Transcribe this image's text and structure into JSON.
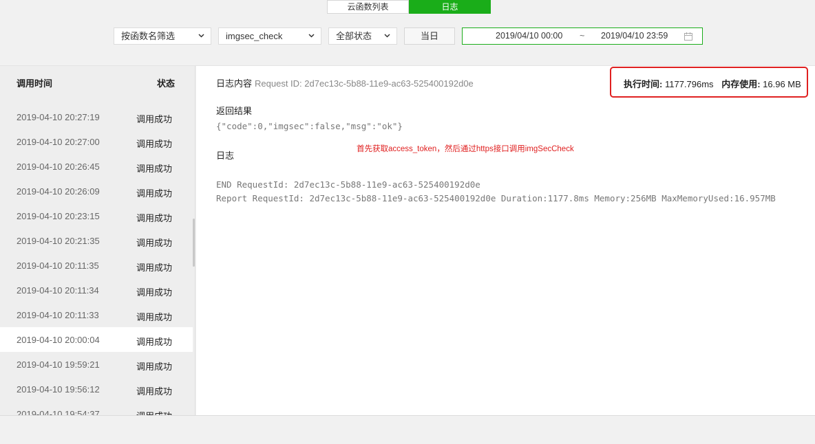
{
  "tabs": [
    {
      "label": "云函数列表",
      "active": false
    },
    {
      "label": "日志",
      "active": true
    }
  ],
  "filters": {
    "by_function": "按函数名筛选",
    "function_name": "imgsec_check",
    "status": "全部状态",
    "today_button": "当日",
    "date_start": "2019/04/10 00:00",
    "date_sep": "~",
    "date_end": "2019/04/10 23:59",
    "calendar_icon": "calendar-icon"
  },
  "list": {
    "header_time": "调用时间",
    "header_status": "状态",
    "rows": [
      {
        "time": "2019-04-10 20:27:19",
        "status": "调用成功"
      },
      {
        "time": "2019-04-10 20:27:00",
        "status": "调用成功"
      },
      {
        "time": "2019-04-10 20:26:45",
        "status": "调用成功"
      },
      {
        "time": "2019-04-10 20:26:09",
        "status": "调用成功"
      },
      {
        "time": "2019-04-10 20:23:15",
        "status": "调用成功"
      },
      {
        "time": "2019-04-10 20:21:35",
        "status": "调用成功"
      },
      {
        "time": "2019-04-10 20:11:35",
        "status": "调用成功"
      },
      {
        "time": "2019-04-10 20:11:34",
        "status": "调用成功"
      },
      {
        "time": "2019-04-10 20:11:33",
        "status": "调用成功"
      },
      {
        "time": "2019-04-10 20:00:04",
        "status": "调用成功",
        "selected": true
      },
      {
        "time": "2019-04-10 19:59:21",
        "status": "调用成功"
      },
      {
        "time": "2019-04-10 19:56:12",
        "status": "调用成功"
      },
      {
        "time": "2019-04-10 19:54:37",
        "status": "调用成功"
      }
    ]
  },
  "detail": {
    "title": "日志内容",
    "request_id_label": "Request ID: 2d7ec13c-5b88-11e9-ac63-525400192d0e",
    "exec_time_label": "执行时间:",
    "exec_time_value": "1177.796ms",
    "memory_label": "内存使用:",
    "memory_value": "16.96 MB",
    "result_label": "返回结果",
    "result_value": "{\"code\":0,\"imgsec\":false,\"msg\":\"ok\"}",
    "log_label": "日志",
    "annotation": "首先获取access_token，然后通过https接口调用imgSecCheck",
    "log_line_1": "END RequestId: 2d7ec13c-5b88-11e9-ac63-525400192d0e",
    "log_line_2": "Report RequestId: 2d7ec13c-5b88-11e9-ac63-525400192d0e Duration:1177.8ms Memory:256MB MaxMemoryUsed:16.957MB"
  },
  "colors": {
    "accent_green": "#1aad19",
    "highlight_red": "#e02020"
  }
}
